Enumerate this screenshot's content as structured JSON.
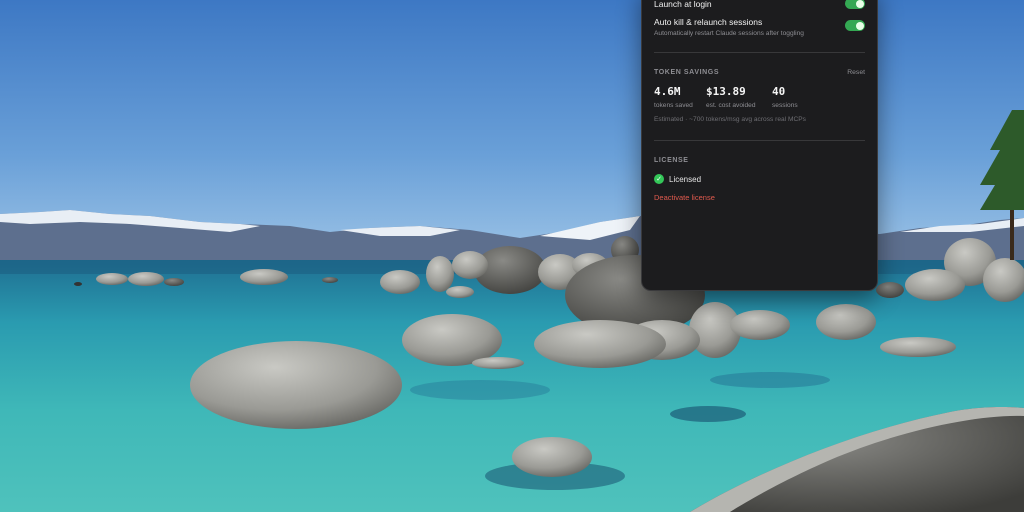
{
  "settings": {
    "launch_at_login": {
      "label": "Launch at login",
      "enabled": true
    },
    "auto_kill": {
      "label": "Auto kill & relaunch sessions",
      "description": "Automatically restart Claude sessions after toggling",
      "enabled": true
    }
  },
  "token_savings": {
    "heading": "TOKEN SAVINGS",
    "reset_label": "Reset",
    "stats": [
      {
        "value": "4.6M",
        "label": "tokens saved"
      },
      {
        "value": "$13.89",
        "label": "est. cost avoided"
      },
      {
        "value": "40",
        "label": "sessions"
      }
    ],
    "estimate_note": "Estimated · ~700 tokens/msg avg across real MCPs"
  },
  "license": {
    "heading": "LICENSE",
    "status": "Licensed",
    "deactivate_label": "Deactivate license"
  },
  "colors": {
    "panel_bg": "#1c1c1e",
    "toggle_on": "#34a853",
    "licensed_check": "#34c759",
    "danger": "#e05a4e"
  },
  "icons": {
    "licensed": "check-circle-icon"
  }
}
